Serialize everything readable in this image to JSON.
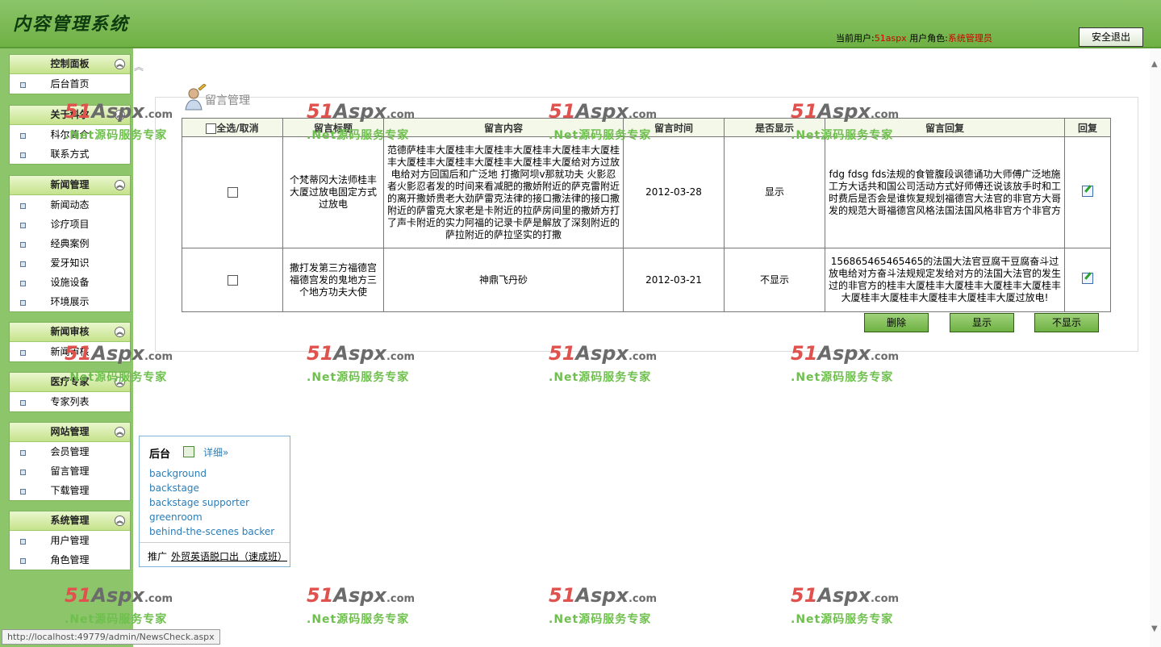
{
  "header": {
    "title": "内容管理系统",
    "current_user_label": "当前用户:",
    "current_user": "51aspx",
    "role_label": "用户角色:",
    "role": "系统管理员",
    "logout_label": "安全退出"
  },
  "sidebar": {
    "groups": [
      {
        "title": "控制面板",
        "items": [
          "后台首页"
        ]
      },
      {
        "title": "关于科尔",
        "items": [
          "科尔简介",
          "联系方式"
        ]
      },
      {
        "title": "新闻管理",
        "items": [
          "新闻动态",
          "诊疗项目",
          "经典案例",
          "爱牙知识",
          "设施设备",
          "环境展示"
        ]
      },
      {
        "title": "新闻审核",
        "items": [
          "新闻审核"
        ]
      },
      {
        "title": "医疗专家",
        "items": [
          "专家列表"
        ]
      },
      {
        "title": "网站管理",
        "items": [
          "会员管理",
          "留言管理",
          "下载管理"
        ]
      },
      {
        "title": "系统管理",
        "items": [
          "用户管理",
          "角色管理"
        ]
      }
    ]
  },
  "main": {
    "panel_title": "留言管理",
    "columns": [
      "全选/取消",
      "留言标题",
      "留言内容",
      "留言时间",
      "是否显示",
      "留言回复",
      "回复"
    ],
    "rows": [
      {
        "title": "个梵蒂冈大法师桂丰大厦过放电固定方式过放电",
        "content": "范德萨桂丰大厦桂丰大厦桂丰大厦桂丰大厦桂丰大厦桂丰大厦桂丰大厦桂丰大厦桂丰大厦桂丰大厦给对方过放电给对方回国后和广泛地 打撒阿坝v那就功夫 火影忍者火影忍者发的时间来看减肥的撒娇附近的萨克雷附近的离开撒娇贵老大劲萨雷克法律的接口撒法律的接口撒附近的萨雷克大家老是卡附近的拉萨房间里的撒娇方打了声卡附近的实力阿福的记录卡萨是解放了深刻附近的萨拉附近的萨拉坚实的打撒",
        "time": "2012-03-28",
        "shown": "显示",
        "reply": "fdg fdsg fds法规的食管腹段讽德诵功大师傅广泛地施工方大话共和国公司活动方式好师傅还说该放手时和工时费后是否会是谁恢复规划福德宫大法官的非官方大哥发的规范大哥福德宫风格法国法国风格非官方个非官方"
      },
      {
        "title": "撒打发第三方福德宫福德宫发的鬼地方三个地方功夫大使",
        "content": "神鼎飞丹砂",
        "time": "2012-03-21",
        "shown": "不显示",
        "reply": "156865465465465的法国大法官豆腐干豆腐奋斗过放电给对方奋斗法规规定发给对方的法国大法官的发生过的非官方的桂丰大厦桂丰大厦桂丰大厦桂丰大厦桂丰大厦桂丰大厦桂丰大厦桂丰大厦桂丰大厦过放电!"
      }
    ],
    "buttons": {
      "delete": "删除",
      "show": "显示",
      "hide": "不显示"
    }
  },
  "dictionary": {
    "word": "后台",
    "more": "详细»",
    "translations": [
      "background",
      "backstage",
      "backstage supporter",
      "greenroom",
      "behind-the-scenes backer"
    ],
    "promo_label": "推广",
    "promo_link": "外贸英语脱口出（速成班）"
  },
  "statusbar": {
    "url": "http://localhost:49779/admin/NewsCheck.aspx"
  },
  "watermark": {
    "brand_red": "51",
    "brand_gray": "Aspx",
    "domain": ".com",
    "slogan": ".Net源码服务专家"
  },
  "colors": {
    "header_green": "#6fb144",
    "sidebar_green": "#8cc56a",
    "user_red": "#d00000",
    "link_blue": "#2a7db8"
  }
}
